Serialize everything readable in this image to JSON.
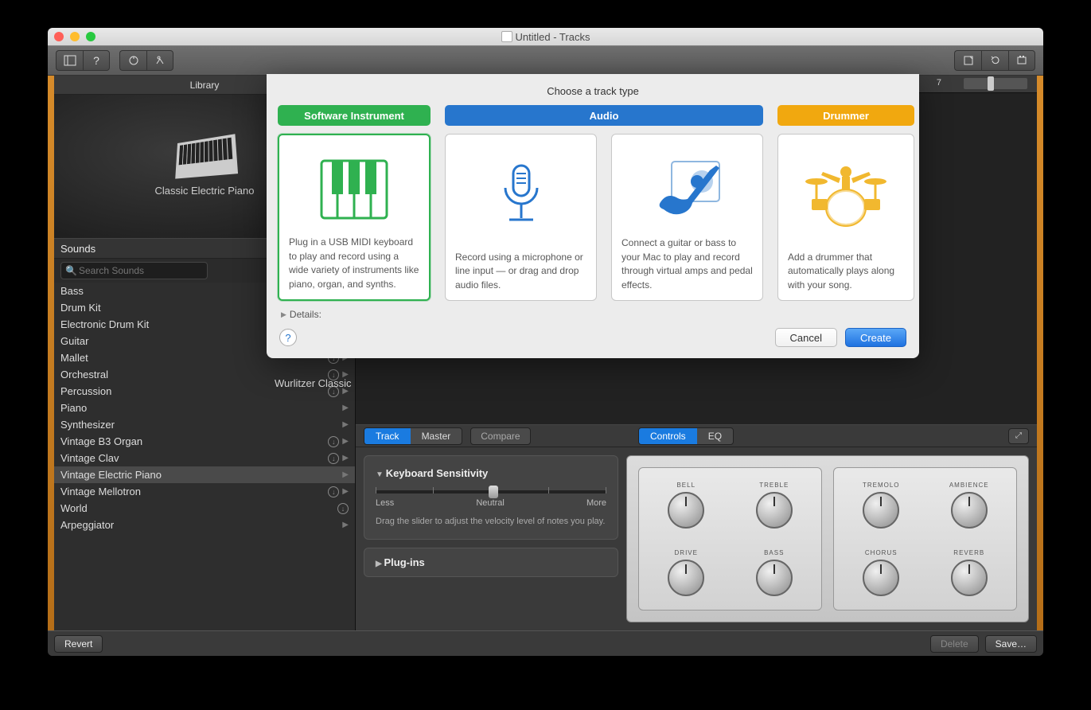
{
  "window": {
    "title": "Untitled - Tracks"
  },
  "toolbar": {
    "icons": [
      "library-icon",
      "help-icon",
      "quick-help-icon",
      "scissors-icon",
      "note-icon",
      "loop-icon",
      "media-icon"
    ]
  },
  "library": {
    "header": "Library",
    "preview_label": "Classic Electric Piano",
    "current_header": "Sounds",
    "search_placeholder": "Search Sounds",
    "categories": [
      {
        "name": "Bass",
        "dl": true,
        "sub": true
      },
      {
        "name": "Drum Kit",
        "dl": true,
        "sub": true
      },
      {
        "name": "Electronic Drum Kit",
        "dl": false,
        "sub": true
      },
      {
        "name": "Guitar",
        "dl": true,
        "sub": true
      },
      {
        "name": "Mallet",
        "dl": true,
        "sub": true
      },
      {
        "name": "Orchestral",
        "dl": true,
        "sub": true
      },
      {
        "name": "Percussion",
        "dl": true,
        "sub": true
      },
      {
        "name": "Piano",
        "dl": false,
        "sub": true
      },
      {
        "name": "Synthesizer",
        "dl": false,
        "sub": true
      },
      {
        "name": "Vintage B3 Organ",
        "dl": true,
        "sub": true
      },
      {
        "name": "Vintage Clav",
        "dl": true,
        "sub": true
      },
      {
        "name": "Vintage Electric Piano",
        "dl": false,
        "sub": true,
        "selected": true
      },
      {
        "name": "Vintage Mellotron",
        "dl": true,
        "sub": true
      },
      {
        "name": "World",
        "dl": true,
        "sub": false
      },
      {
        "name": "Arpeggiator",
        "dl": false,
        "sub": true
      }
    ],
    "col2_item": "Wurlitzer Classic",
    "footer": {
      "revert": "Revert",
      "delete": "Delete",
      "save": "Save…"
    }
  },
  "ruler": {
    "marker": "7"
  },
  "smart": {
    "tabs1": [
      "Track",
      "Master"
    ],
    "active1": 0,
    "compare": "Compare",
    "tabs2": [
      "Controls",
      "EQ"
    ],
    "active2": 0,
    "panel1": {
      "title": "Keyboard Sensitivity",
      "min": "Less",
      "mid": "Neutral",
      "max": "More",
      "hint": "Drag the slider to adjust the velocity level of notes you play."
    },
    "panel2": "Plug-ins",
    "knob_groups": [
      [
        "BELL",
        "TREBLE",
        "DRIVE",
        "BASS"
      ],
      [
        "TREMOLO",
        "AMBIENCE",
        "CHORUS",
        "REVERB"
      ]
    ]
  },
  "modal": {
    "title": "Choose a track type",
    "software": {
      "label": "Software Instrument",
      "desc": "Plug in a USB MIDI keyboard to play and record using a wide variety of instruments like piano, organ, and synths."
    },
    "audio": {
      "label": "Audio",
      "mic_desc": "Record using a microphone or line input — or drag and drop audio files.",
      "guitar_desc": "Connect a guitar or bass to your Mac to play and record through virtual amps and pedal effects."
    },
    "drummer": {
      "label": "Drummer",
      "desc": "Add a drummer that automatically plays along with your song."
    },
    "details": "Details:",
    "cancel": "Cancel",
    "create": "Create"
  }
}
